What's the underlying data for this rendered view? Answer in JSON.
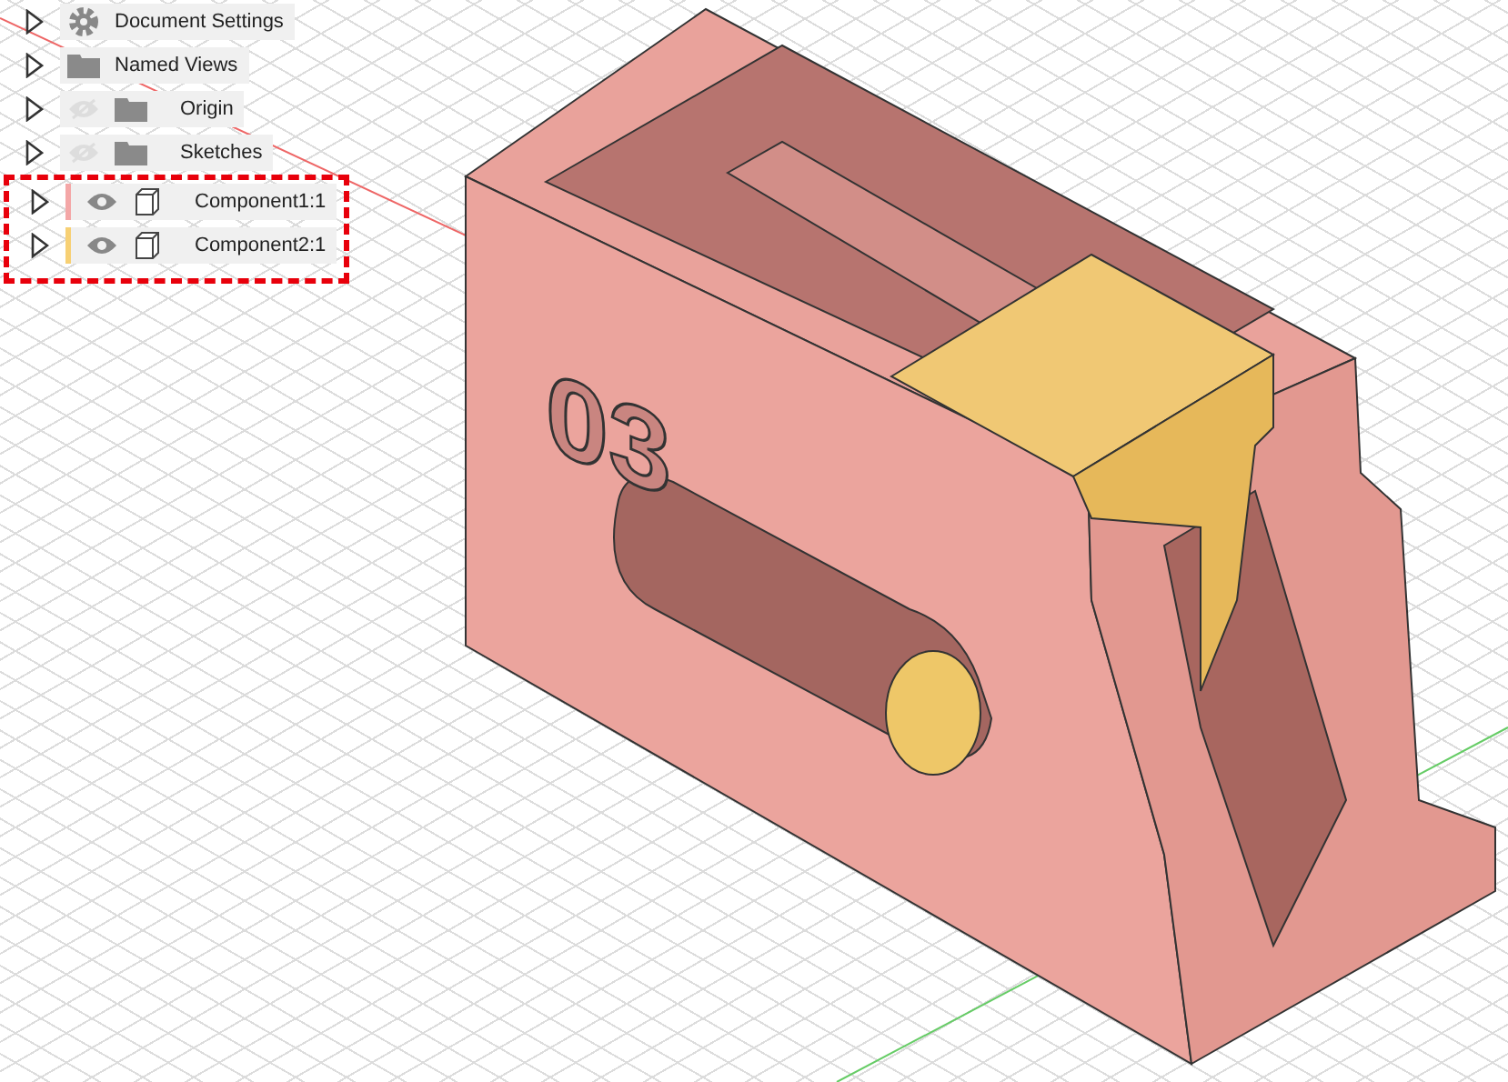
{
  "browser": {
    "items": [
      {
        "label": "Document Settings",
        "kind": "settings",
        "highlighted": false
      },
      {
        "label": "Named Views",
        "kind": "folder",
        "highlighted": false
      },
      {
        "label": "Origin",
        "kind": "folder",
        "visible": false,
        "highlighted": false
      },
      {
        "label": "Sketches",
        "kind": "folder",
        "visible": false,
        "highlighted": false
      },
      {
        "label": "Component1:1",
        "kind": "component",
        "visible": true,
        "color": "#f4a7a7",
        "highlighted": true
      },
      {
        "label": "Component2:1",
        "kind": "component",
        "visible": true,
        "color": "#f7d074",
        "highlighted": true
      }
    ]
  },
  "model": {
    "engraving": "03"
  }
}
